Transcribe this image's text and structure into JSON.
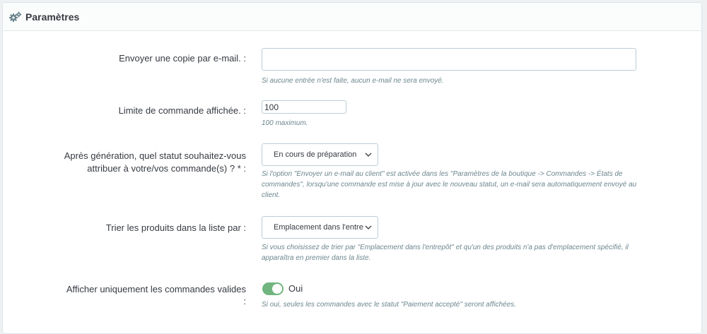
{
  "panel": {
    "title": "Paramètres",
    "icon": "gears-icon"
  },
  "fields": {
    "email_copy": {
      "label": "Envoyer une copie par e-mail. :",
      "value": "",
      "help": "Si aucune entrée n'est faite, aucun e-mail ne sera envoyé."
    },
    "order_limit": {
      "label": "Limite de commande affichée. :",
      "value": "100",
      "help": "100 maximum."
    },
    "status_after": {
      "label_line1": "Après génération, quel statut souhaitez-vous",
      "label_line2": "attribuer à votre/vos commande(s) ? * :",
      "selected": "En cours de préparation",
      "help": "Si l'option \"Envoyer un e-mail au client\" est activée dans les \"Paramètres de la boutique -> Commandes -> États de commandes\", lorsqu'une commande est mise à jour avec le nouveau statut, un e-mail sera automatiquement envoyé au client."
    },
    "sort_products": {
      "label": "Trier les produits dans la liste par :",
      "selected": "Emplacement dans l'entre",
      "help": "Si vous choisissez de trier par \"Emplacement dans l'entrepôt\" et qu'un des produits n'a pas d'emplacement spécifié, il apparaîtra en premier dans la liste."
    },
    "valid_only": {
      "label_line1": "Afficher uniquement les commandes valides",
      "label_line2": ":",
      "toggle_on": true,
      "toggle_label": "Oui",
      "help": "Si oui, seules les commandes avec le statut \"Paiement accepté\" seront affichées."
    }
  },
  "colors": {
    "toggle_on": "#70b580",
    "help_text": "#6c868e"
  }
}
